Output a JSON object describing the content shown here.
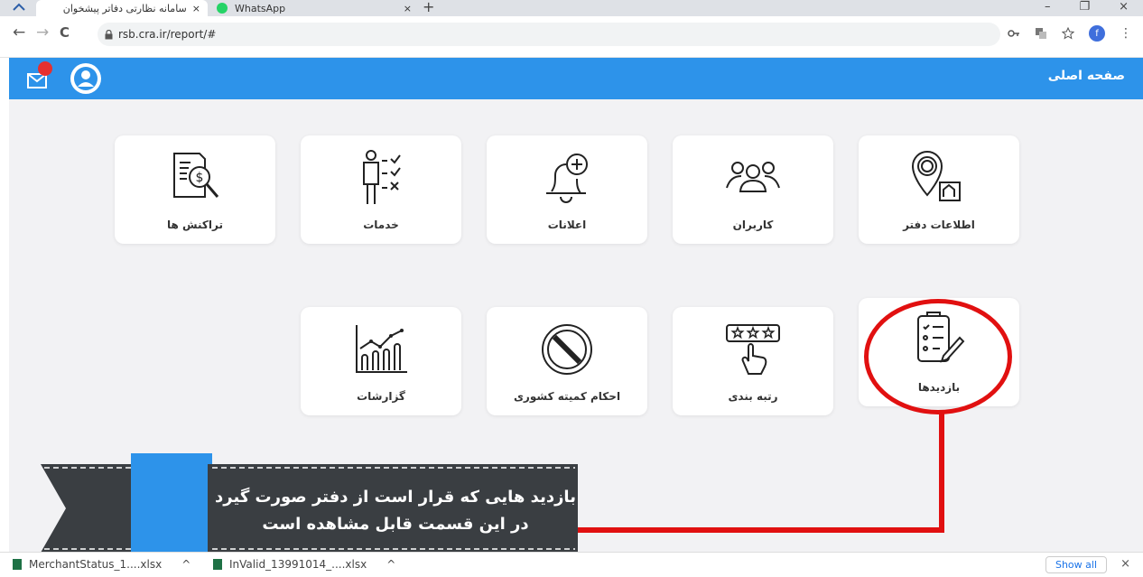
{
  "browser": {
    "tabs": [
      {
        "title": "سامانه نظارتی دفاتر پیشخوان",
        "close": "×",
        "active": true
      },
      {
        "title": "WhatsApp",
        "close": "×",
        "active": false
      }
    ],
    "new_tab": "+",
    "window_buttons": [
      "–",
      "❐",
      "×"
    ],
    "nav": {
      "back": "←",
      "forward": "→",
      "reload": "C"
    },
    "url": "rsb.cra.ir/report/#",
    "toolbar_icons": [
      "key-icon",
      "translate-icon",
      "star-icon"
    ],
    "profile_initial": "f"
  },
  "header": {
    "home_label": "صفحه اصلی",
    "accent": "#2d93ea",
    "badge_color": "#e53030"
  },
  "cards": [
    {
      "id": "office-info",
      "label": "اطلاعات دفتر",
      "icon": "location-office-icon"
    },
    {
      "id": "users",
      "label": "کاربران",
      "icon": "users-group-icon"
    },
    {
      "id": "notifications",
      "label": "اعلانات",
      "icon": "bell-plus-icon"
    },
    {
      "id": "services",
      "label": "خدمات",
      "icon": "person-checklist-icon"
    },
    {
      "id": "transactions",
      "label": "تراکنش ها",
      "icon": "document-search-dollar-icon"
    },
    {
      "id": "visits",
      "label": "بازدیدها",
      "icon": "checklist-pencil-icon"
    },
    {
      "id": "ranking",
      "label": "رتبه بندی",
      "icon": "stars-hand-icon"
    },
    {
      "id": "committee-rulings",
      "label": "احکام کمیته کشوری",
      "icon": "prohibited-icon"
    },
    {
      "id": "reports",
      "label": "گزارشات",
      "icon": "chart-trend-icon"
    }
  ],
  "annotation": {
    "line1": "بازدید هایی که قرار است از دفتر صورت گیرد",
    "line2": "در این قسمت قابل مشاهده است",
    "color": "#e11010",
    "banner_color": "#3a3e42",
    "ribbon_color": "#2d93ea"
  },
  "downloads": {
    "items": [
      {
        "name": "MerchantStatus_1....xlsx",
        "caret": "^"
      },
      {
        "name": "InValid_13991014_....xlsx",
        "caret": "^"
      }
    ],
    "show_all": "Show all",
    "close": "×"
  }
}
